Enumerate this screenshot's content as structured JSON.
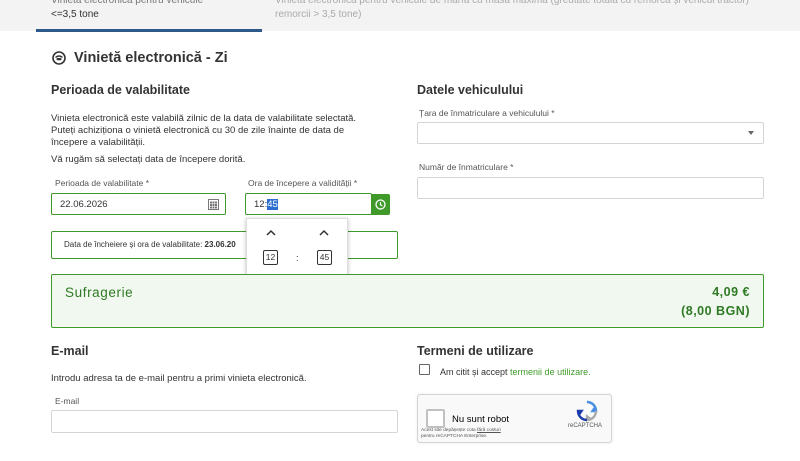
{
  "tabs": {
    "tab1_line1": "Vinietă electronică pentru vehicule",
    "tab1_line2": "<=3,5 tone",
    "tab2_line1": "Vinietă electronică pentru vehicule de marfă cu masa maximă (greutate totală cu remorcă și vehicul tractor)",
    "tab2_line2": "remorcii > 3,5 tone)"
  },
  "section": {
    "title": "Vinietă electronică - Zi"
  },
  "validity": {
    "heading": "Perioada de valabilitate",
    "para1": "Vinieta electronică este valabilă zilnic de la data de valabilitate selectată. Puteți achiziționa o vinietă electronică cu 30 de zile înainte de data de începere a valabilității.",
    "para2": "Vă rugăm să selectați data de începere dorită.",
    "date_label": "Perioada de valabilitate *",
    "date_value": "22.06.2026",
    "time_label": "Ora de începere a validității *",
    "time_hour": "12",
    "time_colon": ":",
    "time_minute": "45",
    "end_label": "Data de încheiere și ora de valabilitate:",
    "end_value": "23.06.20"
  },
  "timepicker": {
    "hour": "12",
    "minute": "45",
    "colon": ":",
    "up": "⌃",
    "down": "⌄"
  },
  "vehicle": {
    "heading": "Datele vehiculului",
    "country_label": "Țara de înmatriculare a vehiculului *",
    "country_value": "",
    "plate_label": "Număr de înmatriculare *",
    "plate_value": ""
  },
  "summary": {
    "name": "Sufragerie",
    "price_eur": "4,09 €",
    "price_bgn": "(8,00 BGN)"
  },
  "email": {
    "heading": "E-mail",
    "para": "Introdu adresa ta de e-mail pentru a primi vinieta electronică.",
    "label": "E-mail",
    "value": ""
  },
  "terms": {
    "heading": "Termeni de utilizare",
    "text": "Am citit și accept",
    "link": "termenii de utilizare."
  },
  "recaptcha": {
    "label": "Nu sunt robot",
    "brand": "reCAPTCHA",
    "fine1": "Acest site depășește cota",
    "fine_link": "fără costuri",
    "fine2": "pentru reCAPTCHA Enterprise."
  },
  "colors": {
    "accent_green": "#3f9a2a",
    "text_green": "#2f7a24",
    "tab_underline": "#2d5a8a",
    "selection_blue": "#2d6fd1"
  }
}
